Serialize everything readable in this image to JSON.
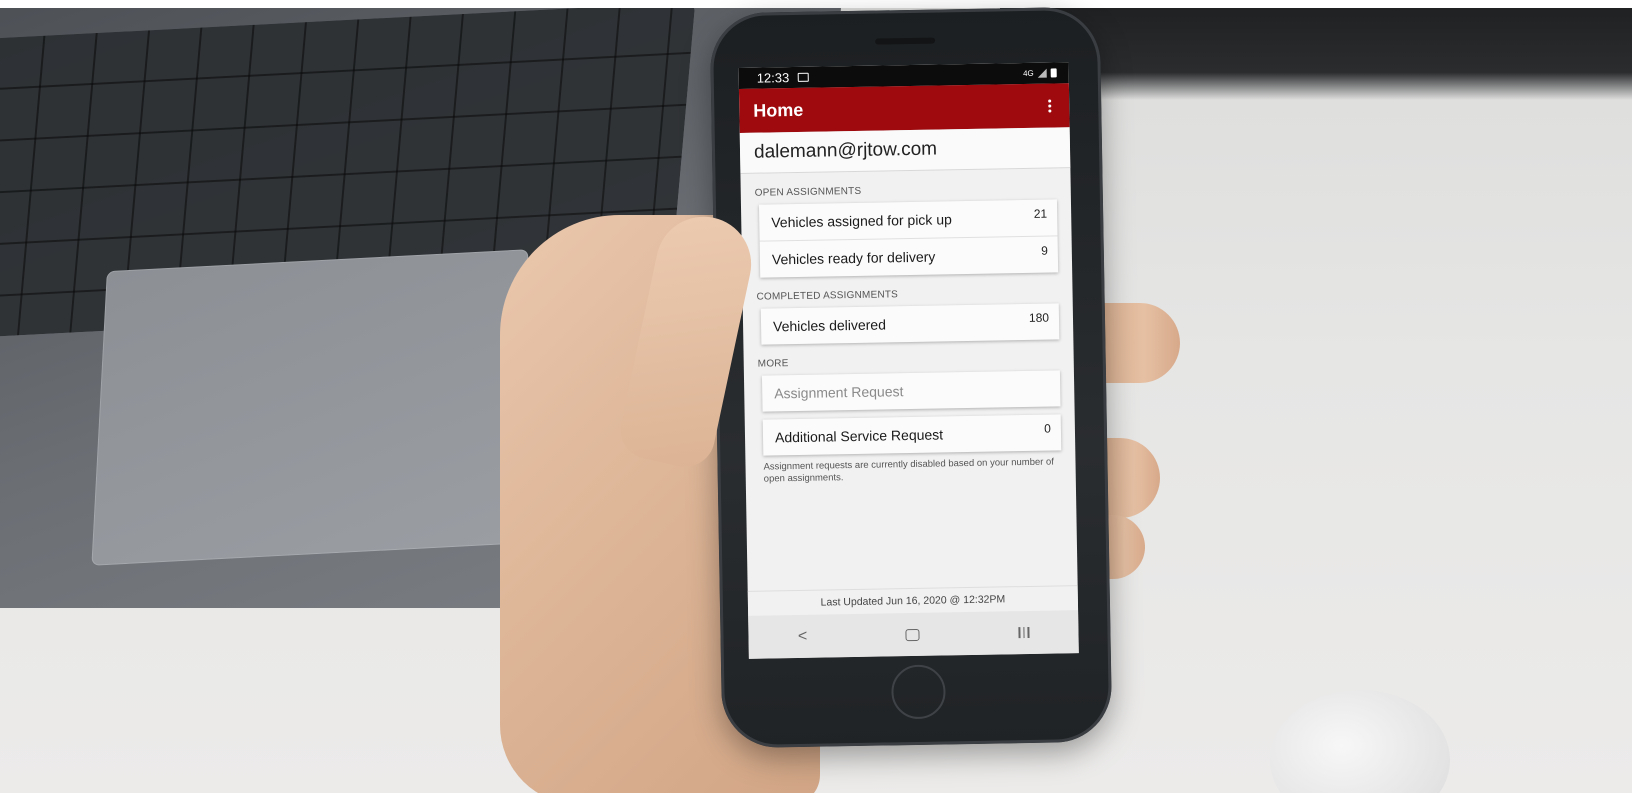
{
  "status_bar": {
    "time": "12:33",
    "network": "4G"
  },
  "app_bar": {
    "title": "Home"
  },
  "account": {
    "email": "dalemann@rjtow.com"
  },
  "sections": {
    "open": {
      "label": "OPEN ASSIGNMENTS",
      "items": [
        {
          "label": "Vehicles assigned for pick up",
          "count": "21"
        },
        {
          "label": "Vehicles ready for delivery",
          "count": "9"
        }
      ]
    },
    "completed": {
      "label": "COMPLETED ASSIGNMENTS",
      "items": [
        {
          "label": "Vehicles delivered",
          "count": "180"
        }
      ]
    },
    "more": {
      "label": "MORE",
      "assignment_request": "Assignment Request",
      "additional_service": {
        "label": "Additional Service Request",
        "count": "0"
      },
      "note": "Assignment requests are currently disabled based on your number of open assignments."
    }
  },
  "footer": {
    "last_updated": "Last Updated Jun 16, 2020 @ 12:32PM"
  },
  "nav": {
    "back": "<"
  },
  "colors": {
    "app_bar": "#9e0a0e",
    "status_bar": "#0c0c0c",
    "screen_bg": "#f1f1f1"
  }
}
